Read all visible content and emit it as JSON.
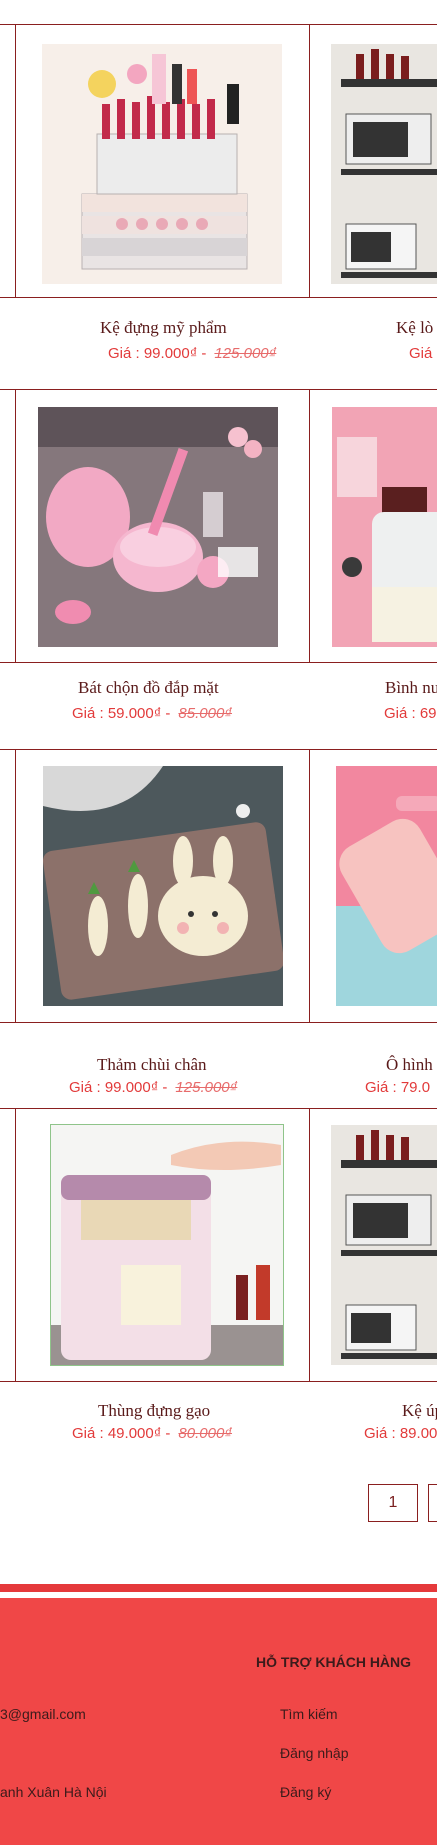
{
  "products": [
    {
      "name_left": "Kệ đựng mỹ phẩm",
      "price_left": "Giá : 99.000₫",
      "old_left": "125.000₫",
      "name_right": "Kệ lò",
      "price_right": "Giá"
    },
    {
      "name_left": "Bát chộn đồ đắp mặt",
      "price_left": "Giá : 59.000₫",
      "old_left": "85.000₫",
      "name_right": "Bình nư",
      "price_right": "Giá : 69"
    },
    {
      "name_left": "Thảm chùi chân",
      "price_left": "Giá : 99.000₫",
      "old_left": "125.000₫",
      "name_right": "Ô hình",
      "price_right": "Giá : 79.0"
    },
    {
      "name_left": "Thùng đựng gạo",
      "price_left": "Giá : 49.000₫",
      "old_left": "80.000₫",
      "name_right": "Kệ úp",
      "price_right": "Giá : 89.00"
    }
  ],
  "separator": "-",
  "pagination": {
    "current": "1"
  },
  "footer": {
    "support_title": "HỖ TRỢ KHÁCH HÀNG",
    "email": "3@gmail.com",
    "address": "anh Xuân Hà Nội",
    "links": [
      "Tìm kiếm",
      "Đăng  nhập",
      "Đăng ký"
    ]
  },
  "colors": {
    "accent": "#f04747",
    "border": "#8a1f1f",
    "price": "#e23a3a"
  }
}
